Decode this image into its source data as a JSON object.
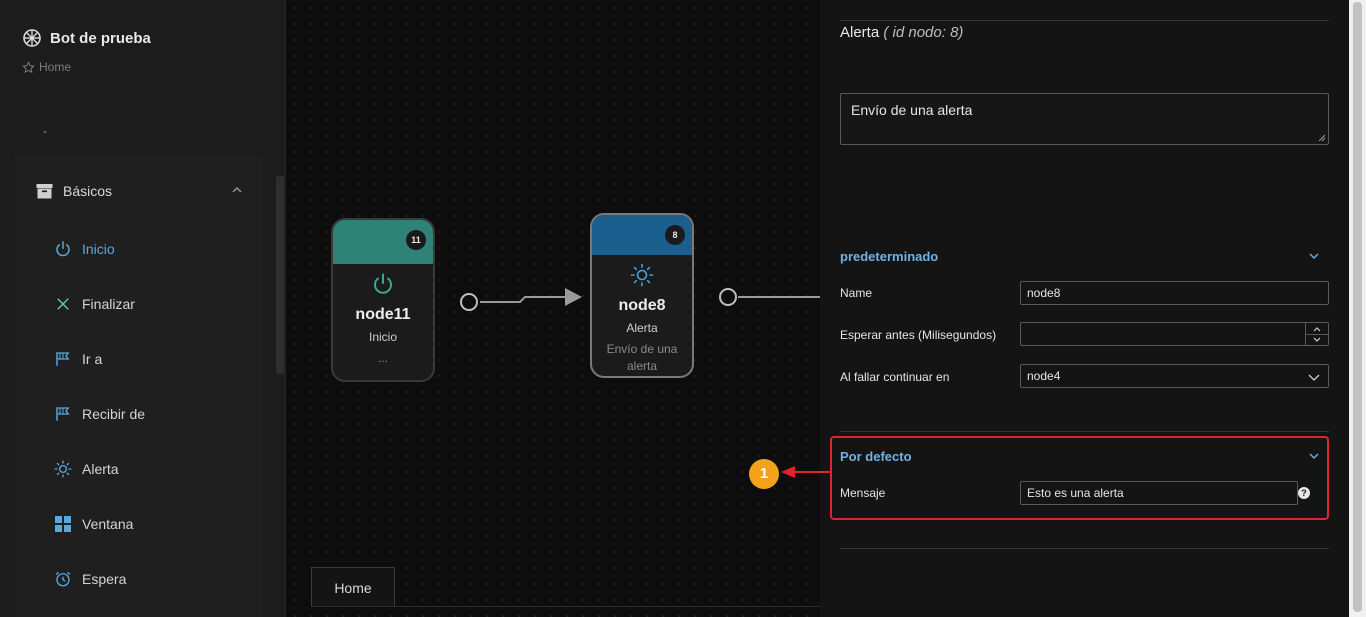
{
  "sidebar": {
    "title": "Bot de prueba",
    "breadcrumb": "Home",
    "dash": "-",
    "group": {
      "label": "Básicos"
    },
    "items": [
      {
        "label": "Inicio",
        "icon": "power-icon",
        "active": true
      },
      {
        "label": "Finalizar",
        "icon": "x-icon"
      },
      {
        "label": "Ir a",
        "icon": "flag-icon"
      },
      {
        "label": "Recibir de",
        "icon": "flag-icon"
      },
      {
        "label": "Alerta",
        "icon": "sun-icon"
      },
      {
        "label": "Ventana",
        "icon": "grid-icon"
      },
      {
        "label": "Espera",
        "icon": "alarm-icon"
      }
    ]
  },
  "canvas": {
    "nodes": [
      {
        "badge": "11",
        "name": "node11",
        "type": "Inicio",
        "desc": "...",
        "header_color": "#2f8376",
        "icon": "power-icon"
      },
      {
        "badge": "8",
        "name": "node8",
        "type": "Alerta",
        "desc": "Envío de una alerta",
        "header_color": "#1b5f8f",
        "icon": "sun-icon"
      }
    ],
    "tab": "Home"
  },
  "panel": {
    "title": "Alerta",
    "title_id": "( id nodo: 8)",
    "description": "Envío de una alerta",
    "section1": {
      "title": "predeterminado",
      "name_label": "Name",
      "name_value": "node8",
      "wait_label": "Esperar antes (Milisegundos)",
      "wait_value": "",
      "fail_label": "Al fallar continuar en",
      "fail_value": "node4"
    },
    "section2": {
      "title": "Por defecto",
      "message_label": "Mensaje",
      "message_value": "Esto es una alerta",
      "help": "?"
    }
  },
  "annotation": {
    "number": "1",
    "color": "#e0242c",
    "badge_color": "#f5a21b"
  }
}
